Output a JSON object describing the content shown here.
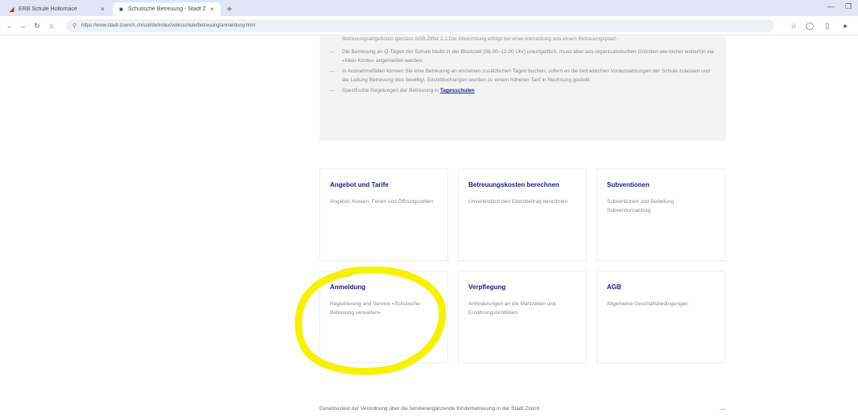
{
  "browser": {
    "tabs": [
      {
        "title": "ERB Schule Hollomace",
        "active": false
      },
      {
        "title": "Schulische Betreuung - Stadt Z",
        "active": true
      }
    ],
    "url": "https://www.stadt-zuerich.ch/ssd/de/index/volksschule/betreuung/anmeldung.html"
  },
  "infobox": {
    "fade_line": "Betreuungsangeboten gemäss AGB Ziffer 2.1 Die Abrechnung erfolgt bei einer Abmeldung aus einem Betreuungsplatz.",
    "items": [
      {
        "text": "Die Betreuung an Q-Tagen der Schule bleibt in der Blockzeit (08.00–12.00 Uhr) unentgeltlich, muss aber aus organisatorischen Gründen wie bisher weiterhin via «Mein Konto» angemeldet werden."
      },
      {
        "text": "In Ausnahmefällen können Sie eine Betreuung an einzelnen zusätzlichen Tagen buchen, sofern es die betrieblichen Voraussetzungen der Schule zulassen und die Leitung Betreuung dies bewilligt. Einzelbuchungen werden zu einem höheren Tarif in Rechnung gestellt."
      },
      {
        "text_before": "Spezifische Regelungen der Betreuung in ",
        "link": "Tagesschulen"
      }
    ]
  },
  "cards": [
    {
      "title": "Angebot und Tarife",
      "desc": "Angebot, Kosten, Ferien und Öffnungszeiten"
    },
    {
      "title": "Betreuungskosten berechnen",
      "desc": "Unverbindlich den Elternbeitrag berechnen"
    },
    {
      "title": "Subventionen",
      "desc": "Subventionen und Bedeilung Subventionsantrag"
    },
    {
      "title": "Anmeldung",
      "desc": "Registrierung und Service «Schulische Betreuung verwalten»"
    },
    {
      "title": "Verpflegung",
      "desc": "Anforderungen an die Mahlzeiten und Ernährungsrichtlinien"
    },
    {
      "title": "AGB",
      "desc": "Allgemeine Geschäftsbedingungen"
    }
  ],
  "footer": {
    "link_text": "Gesetzestext der Verordnung über die familienergänzende Kinderbetreuung in der Stadt Zürich",
    "arrow": "→"
  },
  "icons": {
    "back": "back-arrow-icon",
    "forward": "forward-arrow-icon",
    "reload": "reload-icon",
    "home": "home-icon"
  },
  "colors": {
    "card_title": "#1b1a8a",
    "highlight": "#f5f200",
    "infobox_bg": "#f3f3f3"
  }
}
